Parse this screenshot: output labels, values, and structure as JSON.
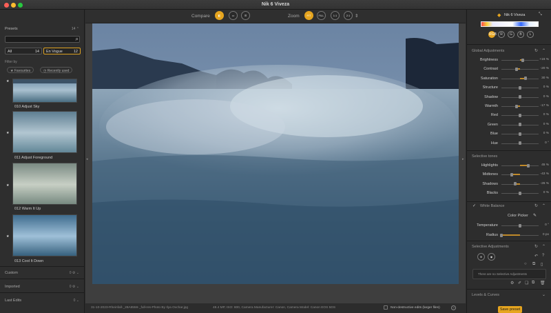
{
  "window": {
    "title": "Nik 6 Viveza"
  },
  "left": {
    "presets_title": "Presets",
    "presets_count": "14",
    "search_placeholder": "",
    "filter_all": {
      "label": "All",
      "count": "14"
    },
    "filter_envogue": {
      "label": "En Vogue",
      "count": "12"
    },
    "filter_by": "Filter by",
    "favourites": "Favourites",
    "recently_used": "Recently used",
    "presets": [
      {
        "label": "010 Adjust Sky"
      },
      {
        "label": "011 Adjust Foreground"
      },
      {
        "label": "012 Warm It Up"
      },
      {
        "label": "013 Cool It Down"
      }
    ],
    "custom": {
      "label": "Custom",
      "count": "0"
    },
    "imported": {
      "label": "Imported",
      "count": "0"
    },
    "last_edits": {
      "label": "Last Edits",
      "count": "0"
    }
  },
  "toolbar": {
    "compare_label": "Compare",
    "zoom_label": "Zoom",
    "zoom_fit": "FIT",
    "zoom_fill": "FILL",
    "zoom_11": "1:1",
    "zoom_21": "2:1"
  },
  "status": {
    "filename": "31-10-2023-Rheinfall-_28A6556-_full-res-Photo By Ilya Ovchar.jpg",
    "info": "48.4 MP, ISO: 800, Camera Manufacturer: Canon, Camera Model: Canon EOS 5DS",
    "nondestructive": "Non-destructive edits (larger files)"
  },
  "right": {
    "product": "Nik 6 Viveza",
    "channels": [
      "RGB",
      "R",
      "G",
      "B",
      "L"
    ],
    "global_title": "Global Adjustments",
    "global": [
      {
        "name": "Brightness",
        "value": "+16 %",
        "level": 0.58
      },
      {
        "name": "Contrast",
        "value": "-20 %",
        "level": 0.4
      },
      {
        "name": "Saturation",
        "value": "30 %",
        "level": 0.65
      },
      {
        "name": "Structure",
        "value": "0 %",
        "level": 0.5
      },
      {
        "name": "Shadow",
        "value": "0 %",
        "level": 0.5
      },
      {
        "name": "Warmth",
        "value": "-17 %",
        "level": 0.41
      },
      {
        "name": "Red",
        "value": "0 %",
        "level": 0.5
      },
      {
        "name": "Green",
        "value": "0 %",
        "level": 0.5
      },
      {
        "name": "Blue",
        "value": "0 %",
        "level": 0.5
      },
      {
        "name": "Hue",
        "value": "0 °",
        "level": 0.5
      }
    ],
    "tones_title": "Selective tones",
    "tones": [
      {
        "name": "Highlights",
        "value": "45 %",
        "level": 0.72
      },
      {
        "name": "Midtones",
        "value": "-43 %",
        "level": 0.28
      },
      {
        "name": "Shadows",
        "value": "-26 %",
        "level": 0.37
      },
      {
        "name": "Blacks",
        "value": "0 %",
        "level": 0.5
      }
    ],
    "wb_title": "White Balance",
    "color_picker": "Color Picker",
    "wb": [
      {
        "name": "Temperature",
        "value": "0 °",
        "level": 0.5
      },
      {
        "name": "Radius",
        "value": "0 px",
        "level": 0.0
      }
    ],
    "selective_title": "Selective Adjustments",
    "no_selective": "There are no Selective Adjustments",
    "levels_title": "Levels & Curves",
    "save_preset": "Save preset"
  },
  "colors": {
    "accent": "#e6a51f"
  }
}
